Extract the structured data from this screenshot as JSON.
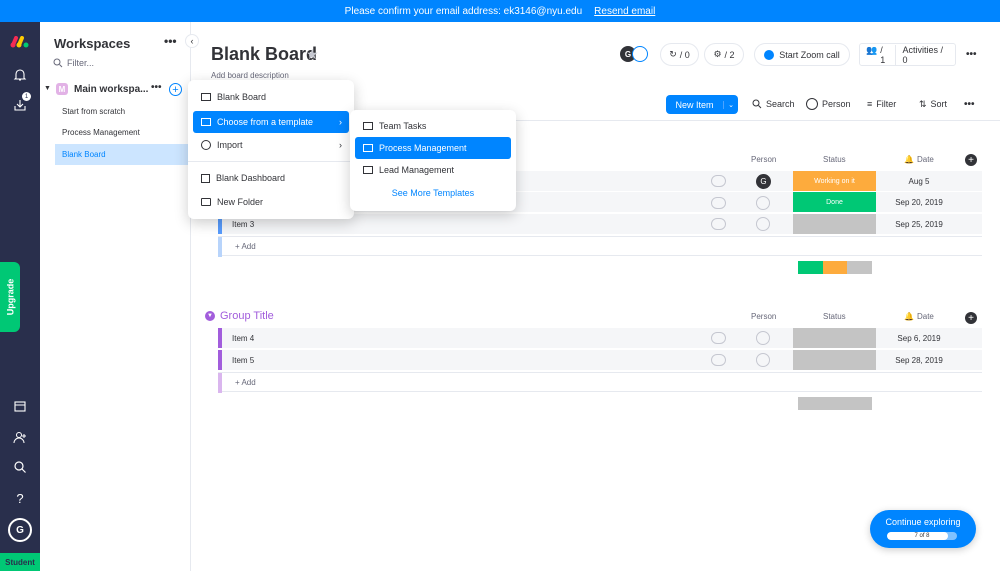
{
  "banner": {
    "text": "Please confirm your email address: ek3146@nyu.edu",
    "link": "Resend email"
  },
  "rail": {
    "inbox_badge": "1",
    "upgrade": "Upgrade",
    "avatar": "G",
    "student": "Student"
  },
  "sidebar": {
    "title": "Workspaces",
    "filter_placeholder": "Filter...",
    "workspace_name": "Main workspa...",
    "workspace_initial": "M",
    "items": [
      {
        "label": "Start from scratch"
      },
      {
        "label": "Process Management"
      },
      {
        "label": "Blank Board"
      }
    ]
  },
  "board": {
    "title": "Blank Board",
    "description": "Add board description"
  },
  "header": {
    "avatar": "G",
    "activity_count": "/ 0",
    "updates_count": "/ 2",
    "zoom": "Start Zoom call",
    "members": "/ 1",
    "activities": "Activities / 0"
  },
  "toolbar": {
    "new_item": "New Item",
    "search": "Search",
    "person": "Person",
    "filter": "Filter",
    "sort": "Sort"
  },
  "menu": {
    "items": [
      {
        "label": "Blank Board"
      },
      {
        "label": "Choose from a template"
      },
      {
        "label": "Import"
      },
      {
        "label": "Blank Dashboard"
      },
      {
        "label": "New Folder"
      }
    ]
  },
  "submenu": {
    "items": [
      {
        "label": "Team Tasks"
      },
      {
        "label": "Process Management"
      },
      {
        "label": "Lead Management"
      }
    ],
    "more": "See More Templates"
  },
  "columns": {
    "person": "Person",
    "status": "Status",
    "date": "Date"
  },
  "group1": {
    "items": [
      {
        "name": "",
        "status": "Working on it",
        "status_color": "#fdab3d",
        "date": "Aug 5",
        "person": "G"
      },
      {
        "name": "",
        "status": "Done",
        "status_color": "#00c875",
        "date": "Sep 20, 2019"
      },
      {
        "name": "Item 3",
        "status": "",
        "status_color": "#c4c4c4",
        "date": "Sep 25, 2019"
      }
    ],
    "add": "+ Add",
    "color": "#579bfc"
  },
  "group2": {
    "title": "Group Title",
    "items": [
      {
        "name": "Item 4",
        "status": "",
        "status_color": "#c4c4c4",
        "date": "Sep 6, 2019"
      },
      {
        "name": "Item 5",
        "status": "",
        "status_color": "#c4c4c4",
        "date": "Sep 28, 2019"
      }
    ],
    "add": "+ Add",
    "color": "#a25ddc"
  },
  "tour": {
    "title": "Continue exploring",
    "progress": "7 of 8",
    "progress_fraction": 0.875
  },
  "colors": {
    "primary": "#0085ff",
    "rail": "#292f4c",
    "green": "#00c875",
    "orange": "#fdab3d"
  }
}
